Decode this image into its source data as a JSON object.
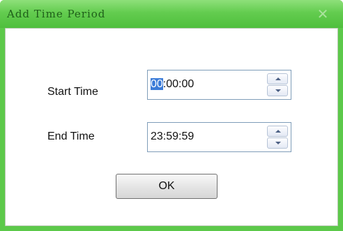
{
  "window": {
    "title": "Add Time Period",
    "close_symbol": "✕"
  },
  "form": {
    "start_time_label": "Start Time",
    "start_time_selected": "00",
    "start_time_rest": ":00:00",
    "end_time_label": "End Time",
    "end_time_value": "23:59:59"
  },
  "buttons": {
    "ok_label": "OK"
  },
  "icons": {
    "close": "close-icon",
    "spin_up": "spin-up-arrow-icon",
    "spin_down": "spin-down-arrow-icon"
  },
  "colors": {
    "titlebar": "#5cc94a",
    "selection": "#3c7cd8"
  }
}
